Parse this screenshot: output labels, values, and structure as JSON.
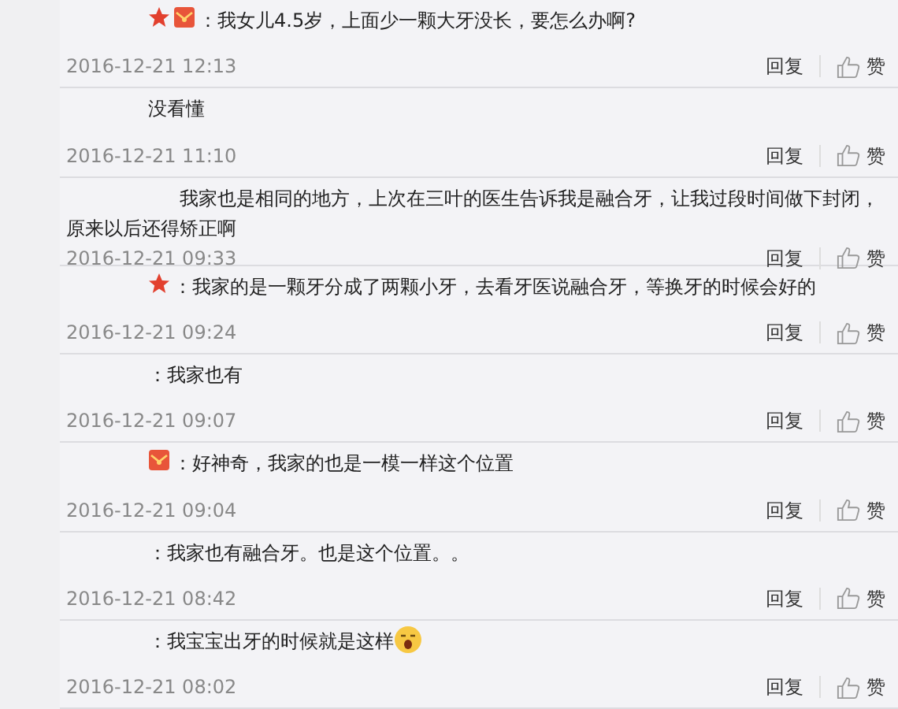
{
  "comments": [
    {
      "icons": [
        {
          "kind": "star"
        },
        {
          "kind": "envelope"
        }
      ],
      "text": "：我女儿4.5岁，上面少一颗大牙没长，要怎么办啊?",
      "time": "2016-12-21 12:13",
      "reply": "回复",
      "like": "赞"
    },
    {
      "text": "没看懂",
      "time": "2016-12-21 11:10",
      "reply": "回复",
      "like": "赞"
    },
    {
      "text": "我家也是相同的地方，上次在三叶的医生告诉我是融合牙，让我过段时间做下封闭，原来以后还得矫正啊",
      "time": "2016-12-21 09:33",
      "reply": "回复",
      "like": "赞"
    },
    {
      "icons": [
        {
          "kind": "star"
        }
      ],
      "text": "：我家的是一颗牙分成了两颗小牙，去看牙医说融合牙，等换牙的时候会好的",
      "time": "2016-12-21 09:24",
      "reply": "回复",
      "like": "赞"
    },
    {
      "text": "：我家也有",
      "time": "2016-12-21 09:07",
      "reply": "回复",
      "like": "赞"
    },
    {
      "icons": [
        {
          "kind": "envelope"
        }
      ],
      "text": "：好神奇，我家的也是一模一样这个位置",
      "time": "2016-12-21 09:04",
      "reply": "回复",
      "like": "赞"
    },
    {
      "text": "：我家也有融合牙。也是这个位置。。",
      "time": "2016-12-21 08:42",
      "reply": "回复",
      "like": "赞"
    },
    {
      "text": "：我宝宝出牙的时候就是这样",
      "time": "2016-12-21 08:02",
      "reply": "回复",
      "like": "赞",
      "emoji": true
    }
  ]
}
